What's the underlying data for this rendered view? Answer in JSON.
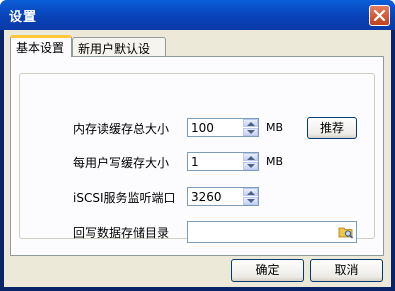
{
  "window": {
    "title": "设置"
  },
  "tabs": [
    {
      "label": "基本设置",
      "active": true
    },
    {
      "label": "新用户默认设置",
      "active": false
    }
  ],
  "form": {
    "cache_total": {
      "label": "内存读缓存总大小",
      "value": "100",
      "unit": "MB"
    },
    "recommend_label": "推荐",
    "per_user_write": {
      "label": "每用户写缓存大小",
      "value": "1",
      "unit": "MB"
    },
    "iscsi_port": {
      "label": "iSCSI服务监听端口",
      "value": "3260"
    },
    "writeback_dir": {
      "label": "回写数据存储目录",
      "value": ""
    }
  },
  "buttons": {
    "ok": "确定",
    "cancel": "取消"
  },
  "colors": {
    "titlebar": "#0842b8",
    "dialog_bg": "#ece9d8",
    "tab_highlight": "#ffc83c"
  },
  "icons": [
    "close-icon",
    "spin-up-icon",
    "spin-down-icon",
    "folder-browse-icon"
  ]
}
